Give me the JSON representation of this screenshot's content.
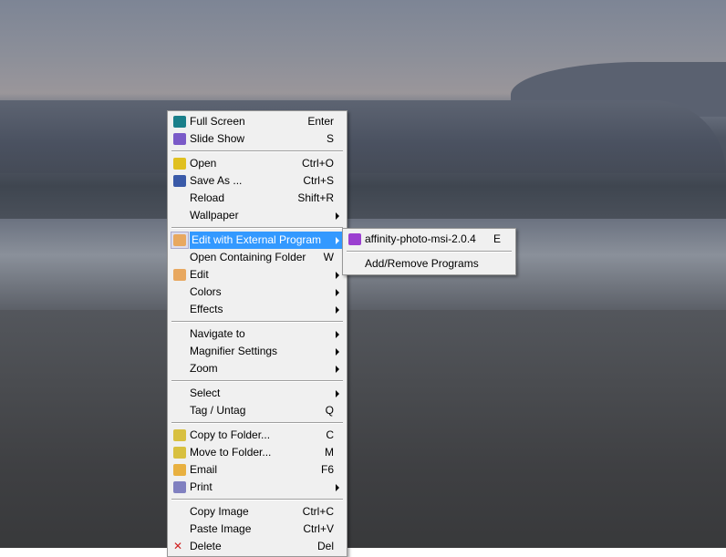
{
  "main_menu": [
    {
      "label": "Full Screen",
      "shortcut": "Enter",
      "icon": "fullscreen-icon",
      "color": "#1a7f8a"
    },
    {
      "label": "Slide Show",
      "shortcut": "S",
      "icon": "slideshow-icon",
      "color": "#7a5ac8"
    },
    {
      "sep": true
    },
    {
      "label": "Open",
      "shortcut": "Ctrl+O",
      "icon": "open-folder-icon",
      "color": "#e0c020"
    },
    {
      "label": "Save As ...",
      "shortcut": "Ctrl+S",
      "icon": "floppy-disk-icon",
      "color": "#3a5aa8"
    },
    {
      "label": "Reload",
      "shortcut": "Shift+R"
    },
    {
      "label": "Wallpaper",
      "submenu": true
    },
    {
      "sep": true
    },
    {
      "label": "Edit with External Program",
      "submenu": true,
      "highlighted": true,
      "icon": "palette-icon",
      "color": "#e8a860"
    },
    {
      "label": "Open Containing Folder",
      "shortcut": "W"
    },
    {
      "label": "Edit",
      "submenu": true,
      "icon": "palette-icon",
      "color": "#e8a860"
    },
    {
      "label": "Colors",
      "submenu": true
    },
    {
      "label": "Effects",
      "submenu": true
    },
    {
      "sep": true
    },
    {
      "label": "Navigate to",
      "submenu": true
    },
    {
      "label": "Magnifier Settings",
      "submenu": true
    },
    {
      "label": "Zoom",
      "submenu": true
    },
    {
      "sep": true
    },
    {
      "label": "Select",
      "submenu": true
    },
    {
      "label": "Tag / Untag",
      "shortcut": "Q"
    },
    {
      "sep": true
    },
    {
      "label": "Copy to Folder...",
      "shortcut": "C",
      "icon": "copy-to-folder-icon",
      "color": "#d8c040"
    },
    {
      "label": "Move to Folder...",
      "shortcut": "M",
      "icon": "move-to-folder-icon",
      "color": "#d8c040"
    },
    {
      "label": "Email",
      "shortcut": "F6",
      "icon": "envelope-icon",
      "color": "#e8b040"
    },
    {
      "label": "Print",
      "submenu": true,
      "icon": "printer-icon",
      "color": "#8080c0"
    },
    {
      "sep": true
    },
    {
      "label": "Copy Image",
      "shortcut": "Ctrl+C"
    },
    {
      "label": "Paste Image",
      "shortcut": "Ctrl+V"
    },
    {
      "label": "Delete",
      "shortcut": "Del",
      "icon": "delete-x-icon",
      "color": "#d02020"
    }
  ],
  "sub_menu": [
    {
      "label": "affinity-photo-msi-2.0.4",
      "shortcut": "E",
      "icon": "affinity-photo-icon",
      "color": "#9b3fd0"
    },
    {
      "sep": true
    },
    {
      "label": "Add/Remove Programs"
    }
  ]
}
